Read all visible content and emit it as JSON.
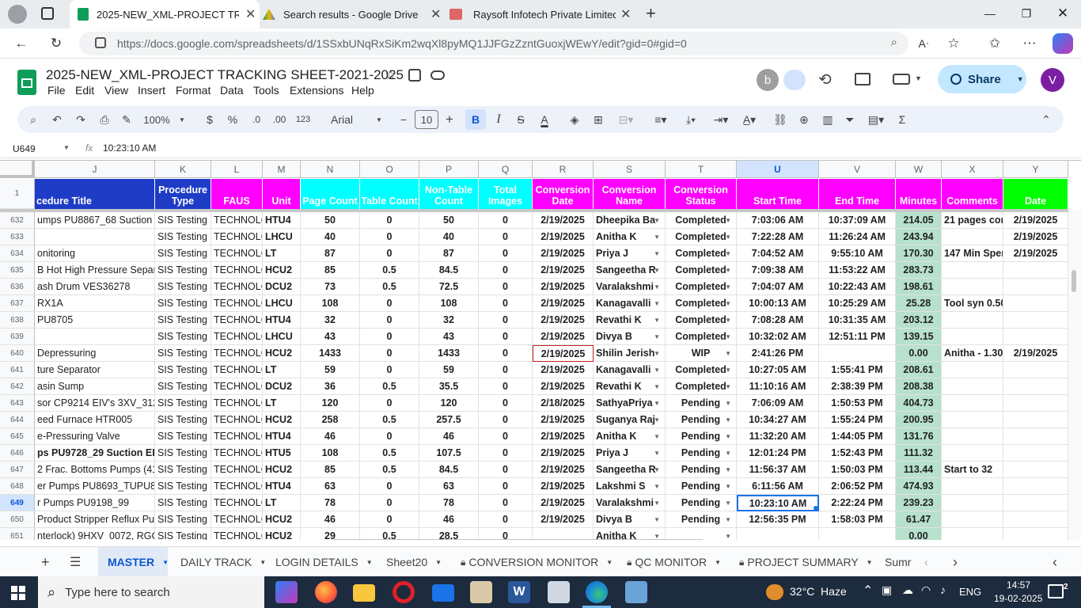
{
  "browser": {
    "tabs": [
      {
        "title": "2025-NEW_XML-PROJECT TRACK",
        "active": true
      },
      {
        "title": "Search results - Google Drive",
        "active": false
      },
      {
        "title": "Raysoft Infotech Private Limited",
        "active": false
      }
    ],
    "url": "https://docs.google.com/spreadsheets/d/1SSxbUNqRxSiKm2wqXl8pyMQ1JJFGzZzntGuoxjWEwY/edit?gid=0#gid=0"
  },
  "doc": {
    "title": "2025-NEW_XML-PROJECT TRACKING SHEET-2021-2025",
    "menu": [
      "File",
      "Edit",
      "View",
      "Insert",
      "Format",
      "Data",
      "Tools",
      "Extensions",
      "Help"
    ],
    "avatar_b": "b",
    "share_label": "Share",
    "account_letter": "V"
  },
  "toolbar": {
    "zoom": "100%",
    "currency": "$",
    "percent": "%",
    "dec_dec": ".0",
    "dec_inc": ".00",
    "numfmt": "123",
    "font": "Arial",
    "font_size": "10",
    "bold": "B",
    "italic": "I",
    "strike": "S",
    "textcolor": "A",
    "sum": "Σ"
  },
  "formula": {
    "cellref": "U649",
    "fx": "fx",
    "value": "10:23:10 AM"
  },
  "columns": [
    "J",
    "K",
    "L",
    "M",
    "N",
    "O",
    "P",
    "Q",
    "R",
    "S",
    "T",
    "U",
    "V",
    "W",
    "X",
    "Y"
  ],
  "header_row_num": "1",
  "headers": [
    "cedure Title",
    "Procedure\nType",
    "FAUS",
    "Unit",
    "Page Count",
    "Table Count",
    "Non-Table\nCount",
    "Total\nImages",
    "Conversion\nDate",
    "Conversion\nName",
    "Conversion\nStatus",
    "Start Time",
    "End Time",
    "Minutes",
    "Comments",
    "Date"
  ],
  "colors": {
    "header_blue": "#1f3cc7",
    "header_cyan": "#00ffff",
    "header_magenta": "#ff00ff",
    "header_green": "#00ff00",
    "minutes_green": "#b7e1cd",
    "selected": "#1a73e8"
  },
  "rows": [
    {
      "n": "632",
      "cells": [
        "umps PU8867_68 Suction El",
        "SIS Testing",
        "TECHNOLOG",
        "HTU4",
        "50",
        "0",
        "50",
        "0",
        "2/19/2025",
        "Dheepika Ba",
        "Completed",
        "7:03:06 AM",
        "10:37:09 AM",
        "214.05",
        "21 pages con",
        "2/19/2025"
      ]
    },
    {
      "n": "633",
      "cells": [
        "",
        "SIS Testing",
        "TECHNOLOG",
        "LHCU",
        "40",
        "0",
        "40",
        "0",
        "2/19/2025",
        "Anitha K",
        "Completed",
        "7:22:28 AM",
        "11:26:24 AM",
        "243.94",
        "",
        "2/19/2025"
      ]
    },
    {
      "n": "634",
      "cells": [
        "onitoring",
        "SIS Testing",
        "TECHNOLOG",
        "LT",
        "87",
        "0",
        "87",
        "0",
        "2/19/2025",
        "Priya J",
        "Completed",
        "7:04:52 AM",
        "9:55:10 AM",
        "170.30",
        "147 Min Sper",
        "2/19/2025"
      ]
    },
    {
      "n": "635",
      "cells": [
        "B Hot High Pressure Separa",
        "SIS Testing",
        "TECHNOLOG",
        "HCU2",
        "85",
        "0.5",
        "84.5",
        "0",
        "2/19/2025",
        "Sangeetha R",
        "Completed",
        "7:09:38 AM",
        "11:53:22 AM",
        "283.73",
        "",
        ""
      ]
    },
    {
      "n": "636",
      "cells": [
        "ash Drum VES36278",
        "SIS Testing",
        "TECHNOLOG",
        "DCU2",
        "73",
        "0.5",
        "72.5",
        "0",
        "2/19/2025",
        "Varalakshmi",
        "Completed",
        "7:04:07 AM",
        "10:22:43 AM",
        "198.61",
        "",
        ""
      ]
    },
    {
      "n": "637",
      "cells": [
        "RX1A",
        "SIS Testing",
        "TECHNOLOG",
        "LHCU",
        "108",
        "0",
        "108",
        "0",
        "2/19/2025",
        "Kanagavalli",
        "Completed",
        "10:00:13 AM",
        "10:25:29 AM",
        "25.28",
        "Tool syn 0.50",
        ""
      ]
    },
    {
      "n": "638",
      "cells": [
        "PU8705",
        "SIS Testing",
        "TECHNOLOG",
        "HTU4",
        "32",
        "0",
        "32",
        "0",
        "2/19/2025",
        "Revathi K",
        "Completed",
        "7:08:28 AM",
        "10:31:35 AM",
        "203.12",
        "",
        ""
      ]
    },
    {
      "n": "639",
      "cells": [
        "",
        "SIS Testing",
        "TECHNOLOG",
        "LHCU",
        "43",
        "0",
        "43",
        "0",
        "2/19/2025",
        "Divya B",
        "Completed",
        "10:32:02 AM",
        "12:51:11 PM",
        "139.15",
        "",
        ""
      ]
    },
    {
      "n": "640",
      "cells": [
        "Depressuring",
        "SIS Testing",
        "TECHNOLOG",
        "HCU2",
        "1433",
        "0",
        "1433",
        "0",
        "2/19/2025",
        "Shilin Jerish",
        "WIP",
        "2:41:26 PM",
        "",
        "0.00",
        "Anitha - 1.30",
        "2/19/2025"
      ]
    },
    {
      "n": "641",
      "cells": [
        "ture Separator",
        "SIS Testing",
        "TECHNOLOG",
        "LT",
        "59",
        "0",
        "59",
        "0",
        "2/19/2025",
        "Kanagavalli",
        "Completed",
        "10:27:05 AM",
        "1:55:41 PM",
        "208.61",
        "",
        ""
      ]
    },
    {
      "n": "642",
      "cells": [
        "asin Sump",
        "SIS Testing",
        "TECHNOLOG",
        "DCU2",
        "36",
        "0.5",
        "35.5",
        "0",
        "2/19/2025",
        "Revathi K",
        "Completed",
        "11:10:16 AM",
        "2:38:39 PM",
        "208.38",
        "",
        ""
      ]
    },
    {
      "n": "643",
      "cells": [
        "sor CP9214 EIV's 3XV_3120",
        "SIS Testing",
        "TECHNOLOG",
        "LT",
        "120",
        "0",
        "120",
        "0",
        "2/18/2025",
        "SathyaPriya",
        "Pending",
        "7:06:09 AM",
        "1:50:53 PM",
        "404.73",
        "",
        ""
      ]
    },
    {
      "n": "644",
      "cells": [
        "eed Furnace HTR005",
        "SIS Testing",
        "TECHNOLOG",
        "HCU2",
        "258",
        "0.5",
        "257.5",
        "0",
        "2/19/2025",
        "Suganya Raj",
        "Pending",
        "10:34:27 AM",
        "1:55:24 PM",
        "200.95",
        "",
        ""
      ]
    },
    {
      "n": "645",
      "cells": [
        "e-Pressuring Valve",
        "SIS Testing",
        "TECHNOLOG",
        "HTU4",
        "46",
        "0",
        "46",
        "0",
        "2/19/2025",
        "Anitha K",
        "Pending",
        "11:32:20 AM",
        "1:44:05 PM",
        "131.76",
        "",
        ""
      ]
    },
    {
      "n": "646",
      "cells": [
        "ps PU9728_29 Suction EIV",
        "SIS Testing",
        "TECHNOLOG",
        "HTU5",
        "108",
        "0.5",
        "107.5",
        "0",
        "2/19/2025",
        "Priya J",
        "Pending",
        "12:01:24 PM",
        "1:52:43 PM",
        "111.32",
        "",
        ""
      ]
    },
    {
      "n": "647",
      "cells": [
        "2 Frac. Bottoms Pumps (416",
        "SIS Testing",
        "TECHNOLOG",
        "HCU2",
        "85",
        "0.5",
        "84.5",
        "0",
        "2/19/2025",
        "Sangeetha R",
        "Pending",
        "11:56:37 AM",
        "1:50:03 PM",
        "113.44",
        "Start to 32",
        ""
      ]
    },
    {
      "n": "648",
      "cells": [
        "er Pumps PU8693_TUPU869",
        "SIS Testing",
        "TECHNOLOG",
        "HTU4",
        "63",
        "0",
        "63",
        "0",
        "2/19/2025",
        "Lakshmi S",
        "Pending",
        "6:11:56 AM",
        "2:06:52 PM",
        "474.93",
        "",
        ""
      ]
    },
    {
      "n": "649",
      "cells": [
        "r Pumps PU9198_99",
        "SIS Testing",
        "TECHNOLOG",
        "LT",
        "78",
        "0",
        "78",
        "0",
        "2/19/2025",
        "Varalakshmi",
        "Pending",
        "10:23:10 AM",
        "2:22:24 PM",
        "239.23",
        "",
        ""
      ]
    },
    {
      "n": "650",
      "cells": [
        "Product Stripper Reflux Pur",
        "SIS Testing",
        "TECHNOLOG",
        "HCU2",
        "46",
        "0",
        "46",
        "0",
        "2/19/2025",
        "Divya B",
        "Pending",
        "12:56:35 PM",
        "1:58:03 PM",
        "61.47",
        "",
        ""
      ]
    },
    {
      "n": "651",
      "cells": [
        "nterlock) 9HXV_0072, RGC",
        "SIS Testing",
        "TECHNOLOG",
        "HCU2",
        "29",
        "0.5",
        "28.5",
        "0",
        "",
        "Anitha K",
        "",
        "",
        "",
        "0.00",
        "",
        ""
      ]
    }
  ],
  "sheets": [
    {
      "label": "MASTER",
      "active": true
    },
    {
      "label": "DAILY TRACK"
    },
    {
      "label": "LOGIN DETAILS"
    },
    {
      "label": "Sheet20"
    },
    {
      "label": "CONVERSION MONITOR",
      "locked": true
    },
    {
      "label": "QC MONITOR",
      "locked": true
    },
    {
      "label": "PROJECT SUMMARY",
      "locked": true
    },
    {
      "label": "Sumr"
    }
  ],
  "taskbar": {
    "search_placeholder": "Type here to search",
    "weather": "32°C  Haze",
    "lang": "ENG",
    "time": "14:57",
    "date": "19-02-2025",
    "notif_count": "2"
  }
}
